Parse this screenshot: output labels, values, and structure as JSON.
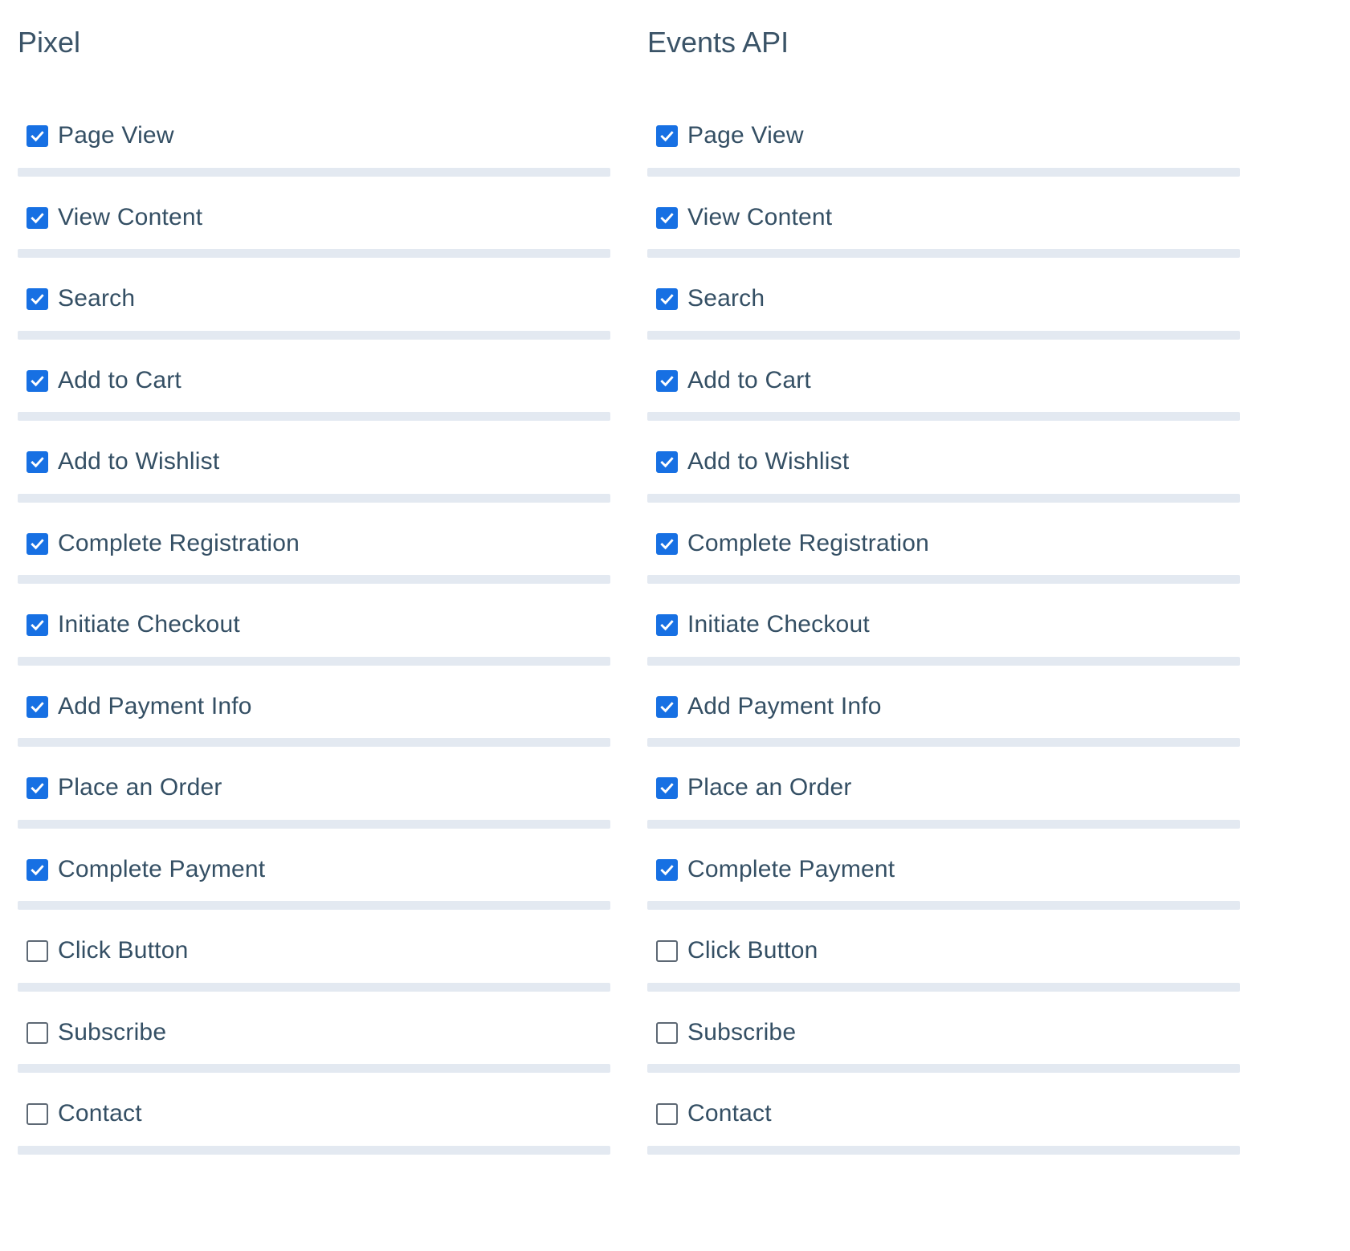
{
  "columns": [
    {
      "id": "pixel",
      "title": "Pixel",
      "events": [
        {
          "label": "Page View",
          "checked": true
        },
        {
          "label": "View Content",
          "checked": true
        },
        {
          "label": "Search",
          "checked": true
        },
        {
          "label": "Add to Cart",
          "checked": true
        },
        {
          "label": "Add to Wishlist",
          "checked": true
        },
        {
          "label": "Complete Registration",
          "checked": true
        },
        {
          "label": "Initiate Checkout",
          "checked": true
        },
        {
          "label": "Add Payment Info",
          "checked": true
        },
        {
          "label": "Place an Order",
          "checked": true
        },
        {
          "label": "Complete Payment",
          "checked": true
        },
        {
          "label": "Click Button",
          "checked": false
        },
        {
          "label": "Subscribe",
          "checked": false
        },
        {
          "label": "Contact",
          "checked": false
        }
      ]
    },
    {
      "id": "events-api",
      "title": "Events API",
      "events": [
        {
          "label": "Page View",
          "checked": true
        },
        {
          "label": "View Content",
          "checked": true
        },
        {
          "label": "Search",
          "checked": true
        },
        {
          "label": "Add to Cart",
          "checked": true
        },
        {
          "label": "Add to Wishlist",
          "checked": true
        },
        {
          "label": "Complete Registration",
          "checked": true
        },
        {
          "label": "Initiate Checkout",
          "checked": true
        },
        {
          "label": "Add Payment Info",
          "checked": true
        },
        {
          "label": "Place an Order",
          "checked": true
        },
        {
          "label": "Complete Payment",
          "checked": true
        },
        {
          "label": "Click Button",
          "checked": false
        },
        {
          "label": "Subscribe",
          "checked": false
        },
        {
          "label": "Contact",
          "checked": false
        }
      ]
    }
  ],
  "colors": {
    "checkbox_checked": "#1770e3",
    "checkbox_unchecked_border": "#5d6874",
    "divider": "#e3e9f1",
    "text": "#344f64"
  },
  "icons": {
    "checked": "checkmark-icon"
  }
}
